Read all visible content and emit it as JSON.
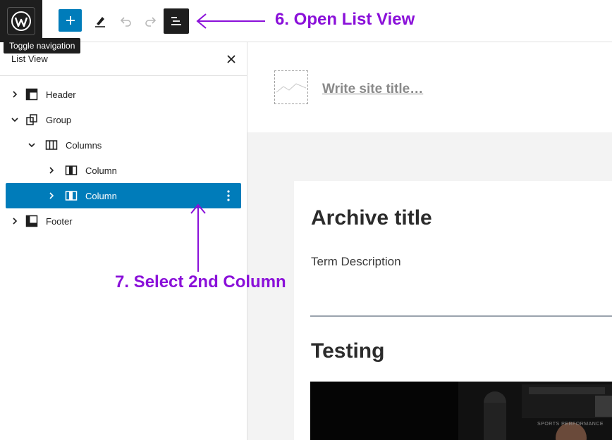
{
  "toolbar": {
    "wp_logo": "wordpress-icon",
    "tooltip": "Toggle navigation",
    "buttons": [
      {
        "name": "add-block",
        "icon": "plus-icon"
      },
      {
        "name": "edit",
        "icon": "pencil-icon"
      },
      {
        "name": "undo",
        "icon": "undo-icon"
      },
      {
        "name": "redo",
        "icon": "redo-icon"
      },
      {
        "name": "list-view",
        "icon": "list-view-icon"
      }
    ],
    "accent_color": "#007cba"
  },
  "list_view": {
    "title": "List View",
    "close_icon": "close-icon",
    "items": [
      {
        "label": "Header",
        "icon": "header-block-icon",
        "expanded": false,
        "level": 1
      },
      {
        "label": "Group",
        "icon": "group-block-icon",
        "expanded": true,
        "level": 1
      },
      {
        "label": "Columns",
        "icon": "columns-block-icon",
        "expanded": true,
        "level": 2
      },
      {
        "label": "Column",
        "icon": "column-block-icon",
        "expanded": false,
        "level": 3
      },
      {
        "label": "Column",
        "icon": "column-block-icon",
        "expanded": false,
        "level": 3,
        "selected": true
      },
      {
        "label": "Footer",
        "icon": "footer-block-icon",
        "expanded": false,
        "level": 1
      }
    ]
  },
  "canvas": {
    "site_title_placeholder": "Write site title…",
    "archive_title": "Archive title",
    "term_description": "Term Description",
    "post_title": "Testing",
    "featured_image_text": "SPORTS PERFORMANCE"
  },
  "annotations": {
    "step6": "6. Open List View",
    "step7": "7.  Select 2nd Column",
    "color": "#8a10d9"
  }
}
